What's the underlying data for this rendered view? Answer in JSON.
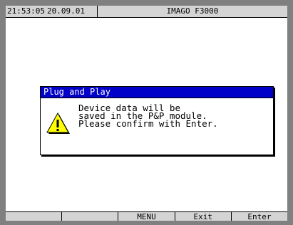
{
  "status_bar": {
    "time": "21:53:05",
    "date": "20.09.01",
    "title": "IMAGO F3000"
  },
  "dialog": {
    "title": "Plug and Play",
    "icon": "warning-icon",
    "lines": [
      "Device data will be",
      "saved in the P&P module.",
      "Please confirm with Enter."
    ]
  },
  "softkeys": [
    "",
    "",
    "MENU",
    "Exit",
    "Enter"
  ],
  "colors": {
    "title_bar": "#0000c8",
    "warning_yellow": "#ffff00",
    "background": "#ffffff"
  }
}
